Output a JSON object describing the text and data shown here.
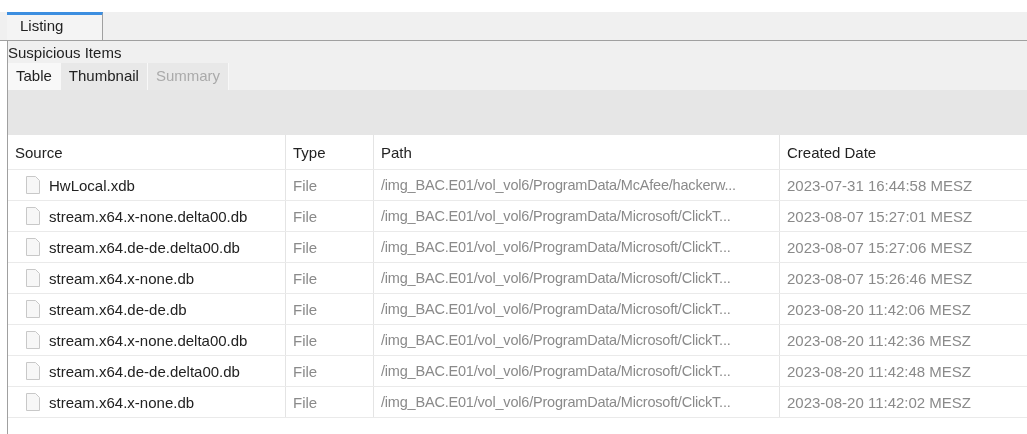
{
  "main_tabs": [
    {
      "label": "Listing",
      "selected": true
    }
  ],
  "panel_title": "Suspicious Items",
  "view_tabs": [
    {
      "label": "Table",
      "selected": true,
      "disabled": false
    },
    {
      "label": "Thumbnail",
      "selected": false,
      "disabled": false
    },
    {
      "label": "Summary",
      "selected": false,
      "disabled": true
    }
  ],
  "table": {
    "columns": [
      "Source",
      "Type",
      "Path",
      "Created Date"
    ],
    "rows": [
      [
        "HwLocal.xdb",
        "File",
        "/img_BAC.E01/vol_vol6/ProgramData/McAfee/hackerw...",
        "2023-07-31 16:44:58 MESZ"
      ],
      [
        "stream.x64.x-none.delta00.db",
        "File",
        "/img_BAC.E01/vol_vol6/ProgramData/Microsoft/ClickT...",
        "2023-08-07 15:27:01 MESZ"
      ],
      [
        "stream.x64.de-de.delta00.db",
        "File",
        "/img_BAC.E01/vol_vol6/ProgramData/Microsoft/ClickT...",
        "2023-08-07 15:27:06 MESZ"
      ],
      [
        "stream.x64.x-none.db",
        "File",
        "/img_BAC.E01/vol_vol6/ProgramData/Microsoft/ClickT...",
        "2023-08-07 15:26:46 MESZ"
      ],
      [
        "stream.x64.de-de.db",
        "File",
        "/img_BAC.E01/vol_vol6/ProgramData/Microsoft/ClickT...",
        "2023-08-20 11:42:06 MESZ"
      ],
      [
        "stream.x64.x-none.delta00.db",
        "File",
        "/img_BAC.E01/vol_vol6/ProgramData/Microsoft/ClickT...",
        "2023-08-20 11:42:36 MESZ"
      ],
      [
        "stream.x64.de-de.delta00.db",
        "File",
        "/img_BAC.E01/vol_vol6/ProgramData/Microsoft/ClickT...",
        "2023-08-20 11:42:48 MESZ"
      ],
      [
        "stream.x64.x-none.db",
        "File",
        "/img_BAC.E01/vol_vol6/ProgramData/Microsoft/ClickT...",
        "2023-08-20 11:42:02 MESZ"
      ]
    ]
  }
}
